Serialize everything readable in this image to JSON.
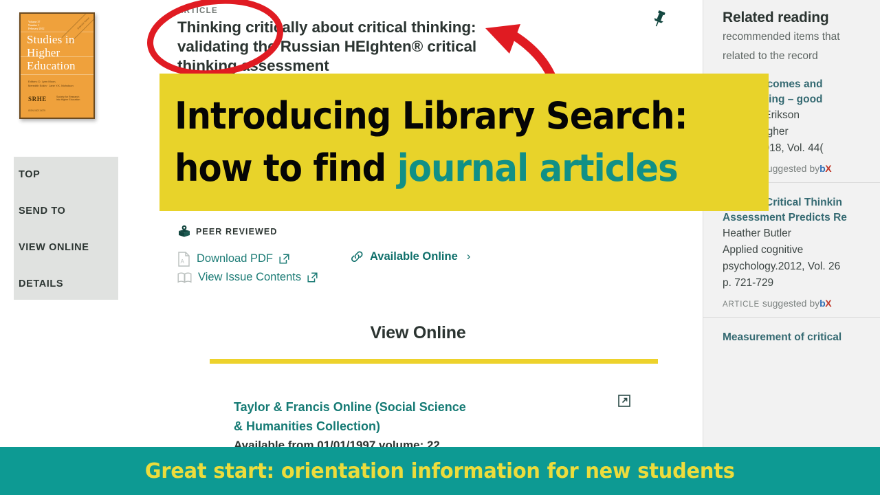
{
  "colors": {
    "banner_bg": "#E8D32A",
    "banner_accent": "#119086",
    "bottom_bar_bg": "#0D9A93",
    "bottom_bar_text": "#ECDC3C",
    "link_teal": "#157A74",
    "annotation_red": "#E01B22",
    "sidebar_bg": "#E0E2E0",
    "related_bg": "#F2F2F2",
    "cover_orange": "#EFA13C"
  },
  "overlay": {
    "banner_line1": "Introducing Library Search:",
    "banner_line2_plain": "how to find ",
    "banner_line2_accent": "journal articles",
    "bottom_bar_text": "Great start: orientation information for new students",
    "circle_annotation": "red-ellipse-around-title",
    "arrow_annotation": "red-curved-arrow-pointing-to-title"
  },
  "cover": {
    "volume_line": "Volume 37\nNumber 1\nFebruary 2012",
    "title": "Studies in Higher Education",
    "editors": "Editors: D. Lynn Moon,\nMeredith Edkin · Jane Y.K. Nicholson",
    "imprint": "SRHE",
    "imprint_sub": "Society for Research\ninto Higher Education",
    "footer": "ISSN 0307-5079",
    "corner_band": "Special Issue"
  },
  "sidebar": {
    "items": [
      {
        "label": "TOP"
      },
      {
        "label": "SEND TO"
      },
      {
        "label": "VIEW ONLINE"
      },
      {
        "label": "DETAILS"
      }
    ]
  },
  "record": {
    "kind": "ARTICLE",
    "title_line1": "Thinking critically about critical thinking:",
    "title_line2": "validating the Russian HEIghten® critical",
    "title_line3": "thinking assessment",
    "peer_reviewed": "PEER REVIEWED",
    "pin_icon": "pushpin-icon",
    "links": [
      {
        "label": "Download PDF",
        "icon": "pdf-file-icon"
      },
      {
        "label": "View Issue Contents",
        "icon": "book-icon"
      }
    ],
    "available_online": {
      "label": "Available Online",
      "icon": "link-chain-icon",
      "chevron": "›"
    }
  },
  "view_online": {
    "heading": "View Online",
    "items": [
      {
        "link_line1": "Taylor & Francis Online (Social Science",
        "link_line2": "& Humanities Collection)",
        "availability": "Available from 01/01/1997 volume: 22",
        "ext_icon": "external-link-icon"
      }
    ]
  },
  "related": {
    "heading": "Related reading",
    "subtitle_line1": "recommended items that",
    "subtitle_line2": "related to the record",
    "items": [
      {
        "title_line1": "...ing outcomes and",
        "title_line2": "...al thinking – good",
        "author": "...orzata Erikson",
        "source_line1": "...es in Higher",
        "source_line2": "...ation.2018, Vol. 44(",
        "suggested_kind": "ARTICLE",
        "suggested_by": "suggested by",
        "suggested_brand": "bX"
      },
      {
        "title_line1": "Halpern Critical Thinkin",
        "title_line2": "Assessment Predicts Re",
        "author": "Heather Butler",
        "source_line1": "Applied cognitive",
        "source_line2": "psychology.2012, Vol. 26",
        "source_line3": "p. 721-729",
        "suggested_kind": "ARTICLE",
        "suggested_by": "suggested by",
        "suggested_brand": "bX"
      },
      {
        "title_line1": "Measurement of critical"
      }
    ]
  }
}
